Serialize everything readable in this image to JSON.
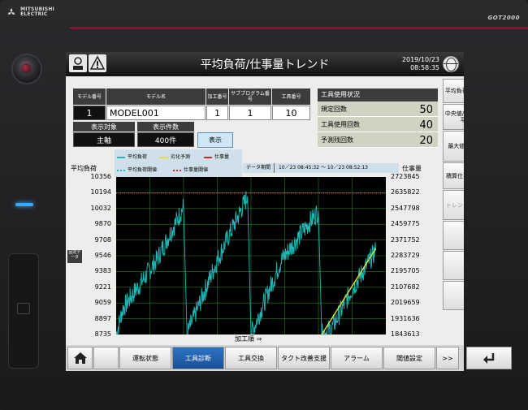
{
  "bezel": {
    "brand_line1": "MITSUBISHI",
    "brand_line2": "ELECTRIC",
    "model": "GOT2000"
  },
  "header": {
    "title": "平均負荷/仕事量トレンド",
    "date": "2019/10/23",
    "time": "08:58:35",
    "left_icons": [
      "gear-person-icon",
      "alert-icon"
    ]
  },
  "info_table": {
    "headers": [
      "モデル番号",
      "モデル名",
      "加工番号",
      "サブプログラム番号",
      "工具番号"
    ],
    "values": [
      "1",
      "MODEL001",
      "1",
      "1",
      "10"
    ]
  },
  "display": {
    "target_label": "表示対象",
    "count_label": "表示件数",
    "target_value": "主軸",
    "count_value": "400件",
    "show_button": "表示"
  },
  "tool_usage": {
    "title": "工具使用状況",
    "rows": [
      {
        "label": "規定回数",
        "value": "50"
      },
      {
        "label": "工具使用回数",
        "value": "40"
      },
      {
        "label": "予測残回数",
        "value": "20"
      }
    ]
  },
  "legend": {
    "items": [
      {
        "label": "平均負荷",
        "color": "#1fb8b8",
        "style": "solid"
      },
      {
        "label": "劣化予測",
        "color": "#e8e030",
        "style": "solid"
      },
      {
        "label": "仕事量",
        "color": "#e02020",
        "style": "solid"
      },
      {
        "label": "平均負荷閾値",
        "color": "#1fb8b8",
        "style": "dotted"
      },
      {
        "label": "仕事量閾値",
        "color": "#e02020",
        "style": "dotted"
      }
    ]
  },
  "period": {
    "label": "データ期間",
    "range": "10／23 08:45:32 ～ 10／23 08:52:13"
  },
  "chart_data": {
    "type": "line",
    "ylabel": "平均負荷",
    "y2label": "仕事量",
    "xlabel": "加工順 ⇒",
    "y_ticks": [
      "10356",
      "10194",
      "10032",
      "9870",
      "9708",
      "9546",
      "9383",
      "9221",
      "9059",
      "8897",
      "8735"
    ],
    "y2_ticks": [
      "2723845",
      "2635822",
      "2547798",
      "2459775",
      "2371752",
      "2283729",
      "2195705",
      "2107682",
      "2019659",
      "1931636",
      "1843613"
    ],
    "ylim": [
      8735,
      10356
    ],
    "y2lim": [
      1843613,
      2723845
    ],
    "xlim": [
      0,
      400
    ],
    "threshold_load": 10194,
    "threshold_work": 2635822,
    "grid": true,
    "series": [
      {
        "name": "平均負荷",
        "color": "#1fb8b8",
        "x": [
          0,
          10,
          60,
          100,
          105,
          150,
          195,
          200,
          245,
          300,
          305,
          320,
          350,
          385
        ],
        "y": [
          8735,
          9000,
          9500,
          10050,
          8735,
          9500,
          10160,
          8735,
          9500,
          10010,
          8735,
          8800,
          9200,
          9600
        ]
      },
      {
        "name": "劣化予測",
        "color": "#e8e030",
        "x": [
          305,
          385
        ],
        "y": [
          8735,
          9620
        ]
      }
    ]
  },
  "fixed_button": "固定データ",
  "side_menu": [
    "平均負荷/仕事量",
    "中央値/指定区間平均",
    "最大値/最小値",
    "積算仕事量比較",
    "トレンドデータ",
    "",
    "",
    ""
  ],
  "bottom_menu": [
    {
      "label": "",
      "icon": "home-icon"
    },
    {
      "label": ""
    },
    {
      "label": "運転状態"
    },
    {
      "label": "工具診断",
      "active": true
    },
    {
      "label": "工具交換"
    },
    {
      "label": "タクト改善支援"
    },
    {
      "label": "アラーム"
    },
    {
      "label": "閾値設定"
    },
    {
      "label": ">>"
    },
    {
      "label": "",
      "icon": "return-icon"
    }
  ]
}
